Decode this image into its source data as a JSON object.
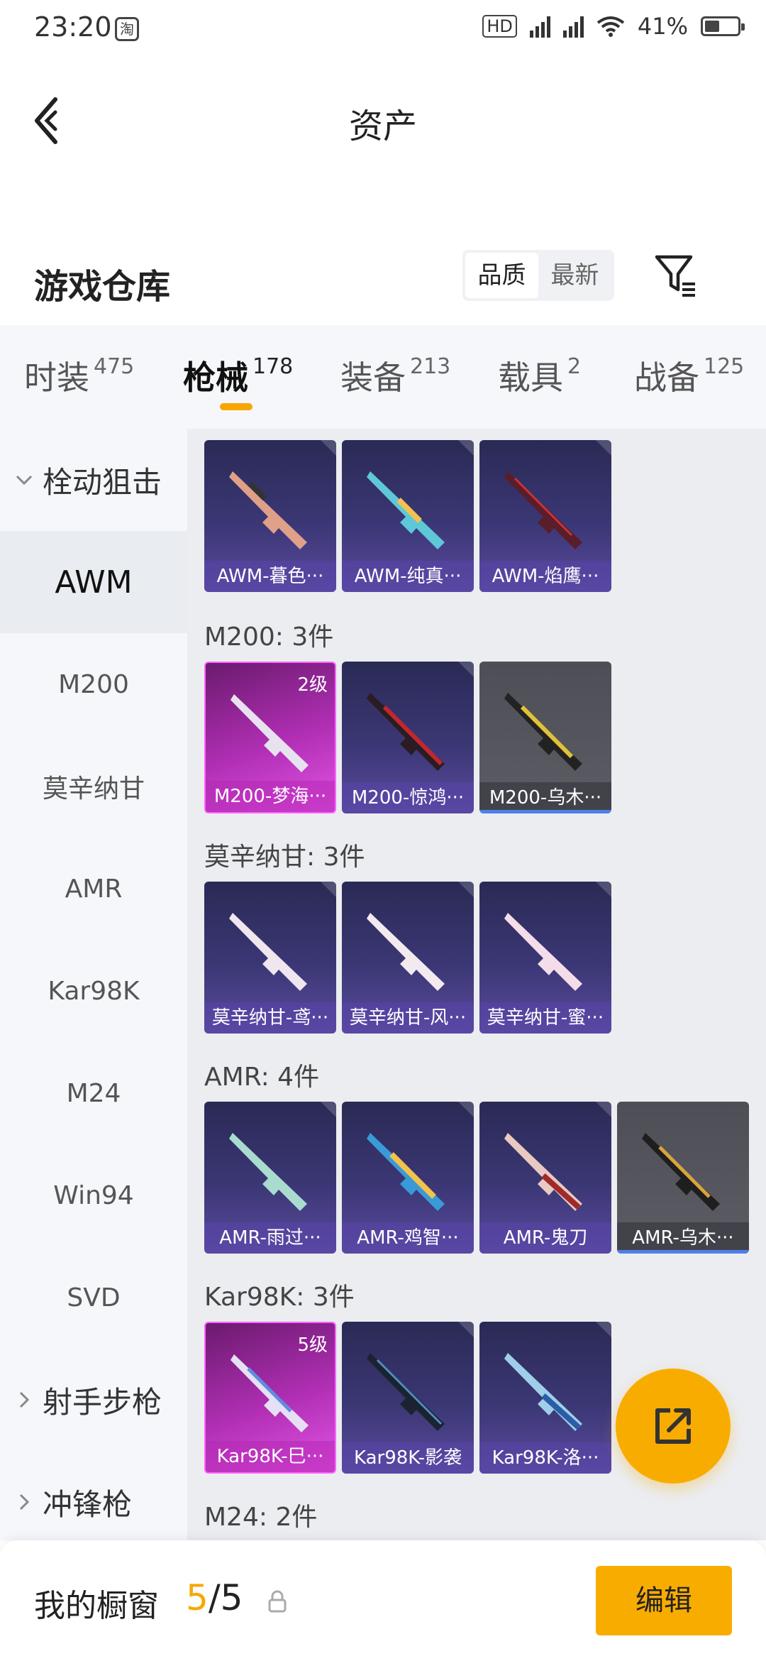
{
  "status_bar": {
    "time": "23:20",
    "app_icon": "淘",
    "battery": "41%"
  },
  "header": {
    "title": "资产"
  },
  "section": {
    "title": "游戏仓库",
    "sort_options": [
      "品质",
      "最新"
    ]
  },
  "category_tabs": [
    {
      "label": "时装",
      "count": "475"
    },
    {
      "label": "枪械",
      "count": "178"
    },
    {
      "label": "装备",
      "count": "213"
    },
    {
      "label": "载具",
      "count": "2"
    },
    {
      "label": "战备",
      "count": "125"
    }
  ],
  "sidebar": {
    "group_open": "栓动狙击",
    "items": [
      "AWM",
      "M200",
      "莫辛纳甘",
      "AMR",
      "Kar98K",
      "M24",
      "Win94",
      "SVD"
    ],
    "group_2": "射手步枪",
    "group_3": "冲锋枪"
  },
  "groups": {
    "awm": {
      "cards": [
        "AWM-暮色···",
        "AWM-纯真···",
        "AWM-焰鹰···"
      ]
    },
    "m200": {
      "label": "M200: 3件",
      "cards": [
        "M200-梦海···",
        "M200-惊鸿···",
        "M200-乌木···"
      ],
      "level": "2级"
    },
    "mosin": {
      "label": "莫辛纳甘: 3件",
      "cards": [
        "莫辛纳甘-鸢···",
        "莫辛纳甘-风···",
        "莫辛纳甘-蜜···"
      ]
    },
    "amr": {
      "label": "AMR: 4件",
      "cards": [
        "AMR-雨过···",
        "AMR-鸡智···",
        "AMR-鬼刀",
        "AMR-乌木···"
      ]
    },
    "kar98k": {
      "label": "Kar98K: 3件",
      "cards": [
        "Kar98K-巳···",
        "Kar98K-影袭",
        "Kar98K-洛···"
      ],
      "level": "5级"
    },
    "m24": {
      "label": "M24: 2件"
    }
  },
  "bottom_bar": {
    "title": "我的橱窗",
    "count_current": "5",
    "count_sep": "/",
    "count_total": "5",
    "edit_label": "编辑"
  },
  "colors": {
    "accent": "#f9ac00",
    "purple_card": "#3b3775",
    "pink_card": "#b12fb5",
    "gray_card": "#5c5c64"
  },
  "icons": [
    "back-icon",
    "filter-icon",
    "chevron-down-icon",
    "chevron-right-icon",
    "share-icon",
    "lock-icon"
  ]
}
